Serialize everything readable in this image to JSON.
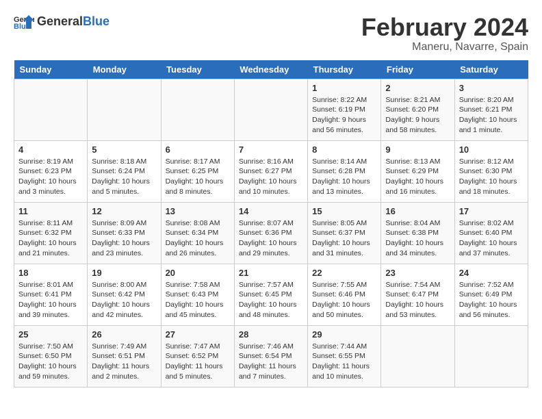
{
  "header": {
    "logo_general": "General",
    "logo_blue": "Blue",
    "title": "February 2024",
    "subtitle": "Maneru, Navarre, Spain"
  },
  "weekdays": [
    "Sunday",
    "Monday",
    "Tuesday",
    "Wednesday",
    "Thursday",
    "Friday",
    "Saturday"
  ],
  "weeks": [
    [
      {
        "day": "",
        "info": ""
      },
      {
        "day": "",
        "info": ""
      },
      {
        "day": "",
        "info": ""
      },
      {
        "day": "",
        "info": ""
      },
      {
        "day": "1",
        "info": "Sunrise: 8:22 AM\nSunset: 6:19 PM\nDaylight: 9 hours and 56 minutes."
      },
      {
        "day": "2",
        "info": "Sunrise: 8:21 AM\nSunset: 6:20 PM\nDaylight: 9 hours and 58 minutes."
      },
      {
        "day": "3",
        "info": "Sunrise: 8:20 AM\nSunset: 6:21 PM\nDaylight: 10 hours and 1 minute."
      }
    ],
    [
      {
        "day": "4",
        "info": "Sunrise: 8:19 AM\nSunset: 6:23 PM\nDaylight: 10 hours and 3 minutes."
      },
      {
        "day": "5",
        "info": "Sunrise: 8:18 AM\nSunset: 6:24 PM\nDaylight: 10 hours and 5 minutes."
      },
      {
        "day": "6",
        "info": "Sunrise: 8:17 AM\nSunset: 6:25 PM\nDaylight: 10 hours and 8 minutes."
      },
      {
        "day": "7",
        "info": "Sunrise: 8:16 AM\nSunset: 6:27 PM\nDaylight: 10 hours and 10 minutes."
      },
      {
        "day": "8",
        "info": "Sunrise: 8:14 AM\nSunset: 6:28 PM\nDaylight: 10 hours and 13 minutes."
      },
      {
        "day": "9",
        "info": "Sunrise: 8:13 AM\nSunset: 6:29 PM\nDaylight: 10 hours and 16 minutes."
      },
      {
        "day": "10",
        "info": "Sunrise: 8:12 AM\nSunset: 6:30 PM\nDaylight: 10 hours and 18 minutes."
      }
    ],
    [
      {
        "day": "11",
        "info": "Sunrise: 8:11 AM\nSunset: 6:32 PM\nDaylight: 10 hours and 21 minutes."
      },
      {
        "day": "12",
        "info": "Sunrise: 8:09 AM\nSunset: 6:33 PM\nDaylight: 10 hours and 23 minutes."
      },
      {
        "day": "13",
        "info": "Sunrise: 8:08 AM\nSunset: 6:34 PM\nDaylight: 10 hours and 26 minutes."
      },
      {
        "day": "14",
        "info": "Sunrise: 8:07 AM\nSunset: 6:36 PM\nDaylight: 10 hours and 29 minutes."
      },
      {
        "day": "15",
        "info": "Sunrise: 8:05 AM\nSunset: 6:37 PM\nDaylight: 10 hours and 31 minutes."
      },
      {
        "day": "16",
        "info": "Sunrise: 8:04 AM\nSunset: 6:38 PM\nDaylight: 10 hours and 34 minutes."
      },
      {
        "day": "17",
        "info": "Sunrise: 8:02 AM\nSunset: 6:40 PM\nDaylight: 10 hours and 37 minutes."
      }
    ],
    [
      {
        "day": "18",
        "info": "Sunrise: 8:01 AM\nSunset: 6:41 PM\nDaylight: 10 hours and 39 minutes."
      },
      {
        "day": "19",
        "info": "Sunrise: 8:00 AM\nSunset: 6:42 PM\nDaylight: 10 hours and 42 minutes."
      },
      {
        "day": "20",
        "info": "Sunrise: 7:58 AM\nSunset: 6:43 PM\nDaylight: 10 hours and 45 minutes."
      },
      {
        "day": "21",
        "info": "Sunrise: 7:57 AM\nSunset: 6:45 PM\nDaylight: 10 hours and 48 minutes."
      },
      {
        "day": "22",
        "info": "Sunrise: 7:55 AM\nSunset: 6:46 PM\nDaylight: 10 hours and 50 minutes."
      },
      {
        "day": "23",
        "info": "Sunrise: 7:54 AM\nSunset: 6:47 PM\nDaylight: 10 hours and 53 minutes."
      },
      {
        "day": "24",
        "info": "Sunrise: 7:52 AM\nSunset: 6:49 PM\nDaylight: 10 hours and 56 minutes."
      }
    ],
    [
      {
        "day": "25",
        "info": "Sunrise: 7:50 AM\nSunset: 6:50 PM\nDaylight: 10 hours and 59 minutes."
      },
      {
        "day": "26",
        "info": "Sunrise: 7:49 AM\nSunset: 6:51 PM\nDaylight: 11 hours and 2 minutes."
      },
      {
        "day": "27",
        "info": "Sunrise: 7:47 AM\nSunset: 6:52 PM\nDaylight: 11 hours and 5 minutes."
      },
      {
        "day": "28",
        "info": "Sunrise: 7:46 AM\nSunset: 6:54 PM\nDaylight: 11 hours and 7 minutes."
      },
      {
        "day": "29",
        "info": "Sunrise: 7:44 AM\nSunset: 6:55 PM\nDaylight: 11 hours and 10 minutes."
      },
      {
        "day": "",
        "info": ""
      },
      {
        "day": "",
        "info": ""
      }
    ]
  ]
}
